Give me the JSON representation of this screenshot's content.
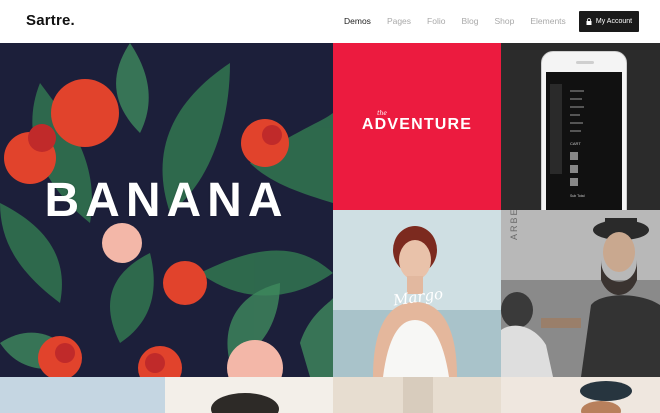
{
  "header": {
    "logo": "Sartre.",
    "nav": [
      "Demos",
      "Pages",
      "Folio",
      "Blog",
      "Shop",
      "Elements"
    ],
    "active_nav": "Demos",
    "account_label": "My Account",
    "account_icon": "lock-icon"
  },
  "tiles": {
    "banana": {
      "title": "BANANA"
    },
    "adventure": {
      "small": "the",
      "title": "ADVENTURE"
    },
    "phone": {
      "cart_label": "CART",
      "total_label": "Sub Total"
    },
    "woman": {
      "signature": "Margo"
    },
    "barber": {
      "sign": "ARBERSHO"
    }
  },
  "colors": {
    "accent_red": "#ec1b3f",
    "banana_bg": "#1c1f3a",
    "account_bg": "#1a1a1a"
  }
}
